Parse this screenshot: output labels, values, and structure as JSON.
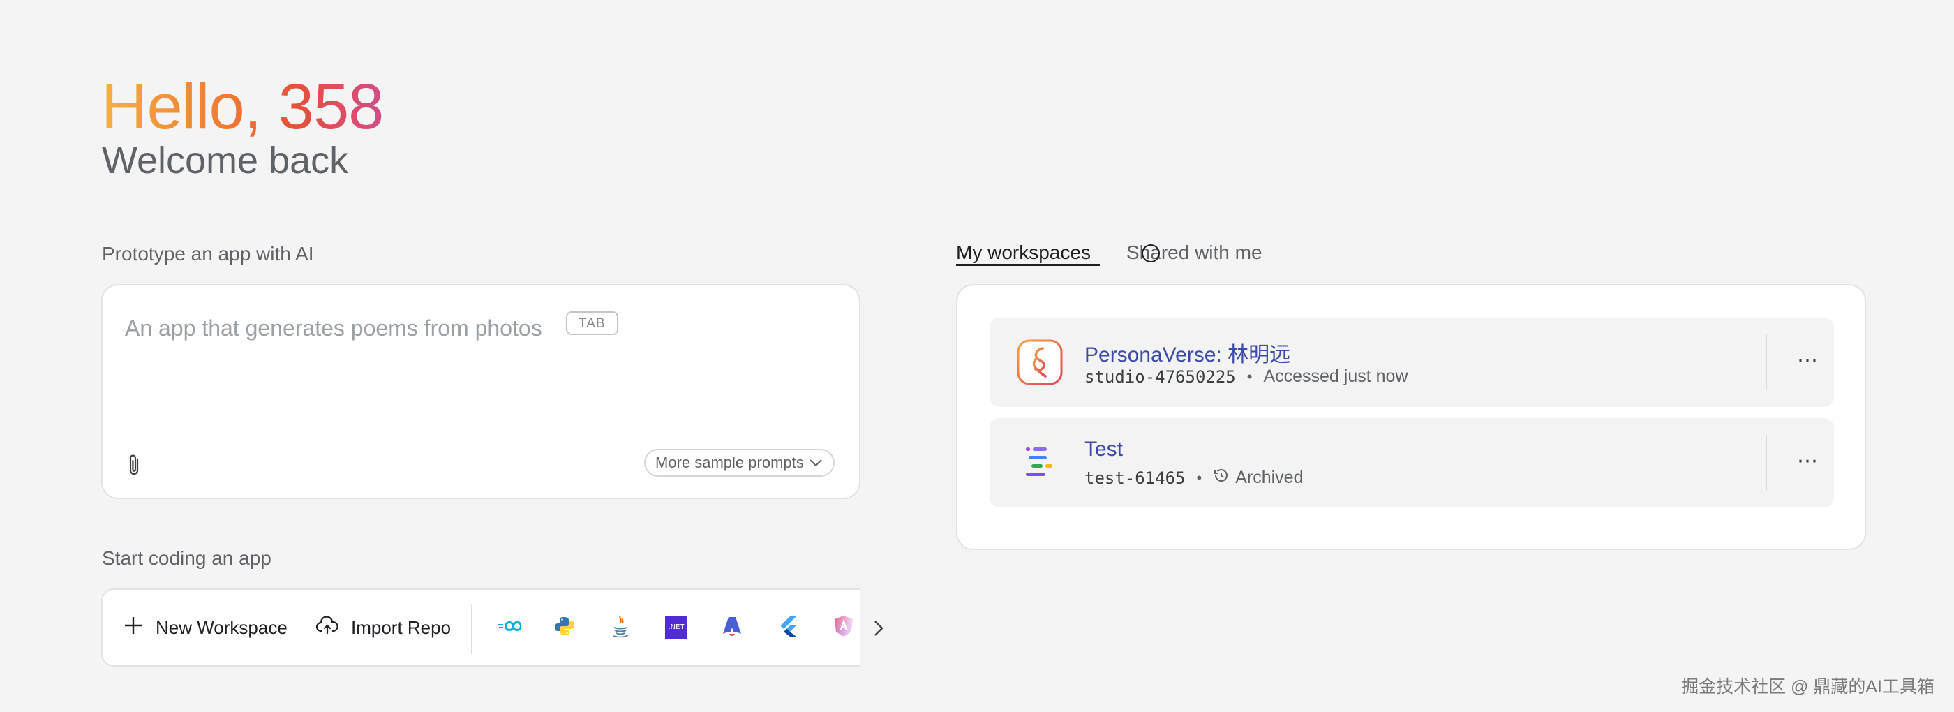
{
  "greeting": {
    "hello": "Hello, 358",
    "welcome": "Welcome back"
  },
  "prototype": {
    "title": "Prototype an app with AI",
    "placeholder": "An app that generates poems from photos",
    "tab_hint": "TAB",
    "more_prompts_label": "More sample prompts"
  },
  "coding": {
    "title": "Start coding an app",
    "new_workspace_label": "New Workspace",
    "import_repo_label": "Import Repo",
    "templates": [
      {
        "icon": "go-icon",
        "color": "#00add8"
      },
      {
        "icon": "python-icon",
        "color": "#3776ab"
      },
      {
        "icon": "java-icon",
        "color": "#e76f00"
      },
      {
        "icon": "dotnet-icon",
        "label": ".NET",
        "color": "#512bd4"
      },
      {
        "icon": "astro-icon",
        "color": "#4a5fd4"
      },
      {
        "icon": "flutter-icon",
        "color": "#42a5f5"
      },
      {
        "icon": "angular-icon",
        "color": "#d94bb0"
      }
    ]
  },
  "workspaces": {
    "tabs": [
      {
        "label": "My workspaces",
        "active": true
      },
      {
        "label": "Shared with me",
        "active": false
      }
    ],
    "items": [
      {
        "name": "PersonaVerse: 林明远",
        "id": "studio-47650225",
        "status": "Accessed just now",
        "icon": "personaverse-icon"
      },
      {
        "name": "Test",
        "id": "test-61465",
        "status": "Archived",
        "icon": "project-bars-icon"
      }
    ],
    "more_glyph": "⋯"
  },
  "watermark": "掘金技术社区 @ 鼎藏的AI工具箱",
  "colors": {
    "accent": "#3c4ba8",
    "greeting_start": "#f4b040",
    "greeting_end": "#d54b8a"
  }
}
